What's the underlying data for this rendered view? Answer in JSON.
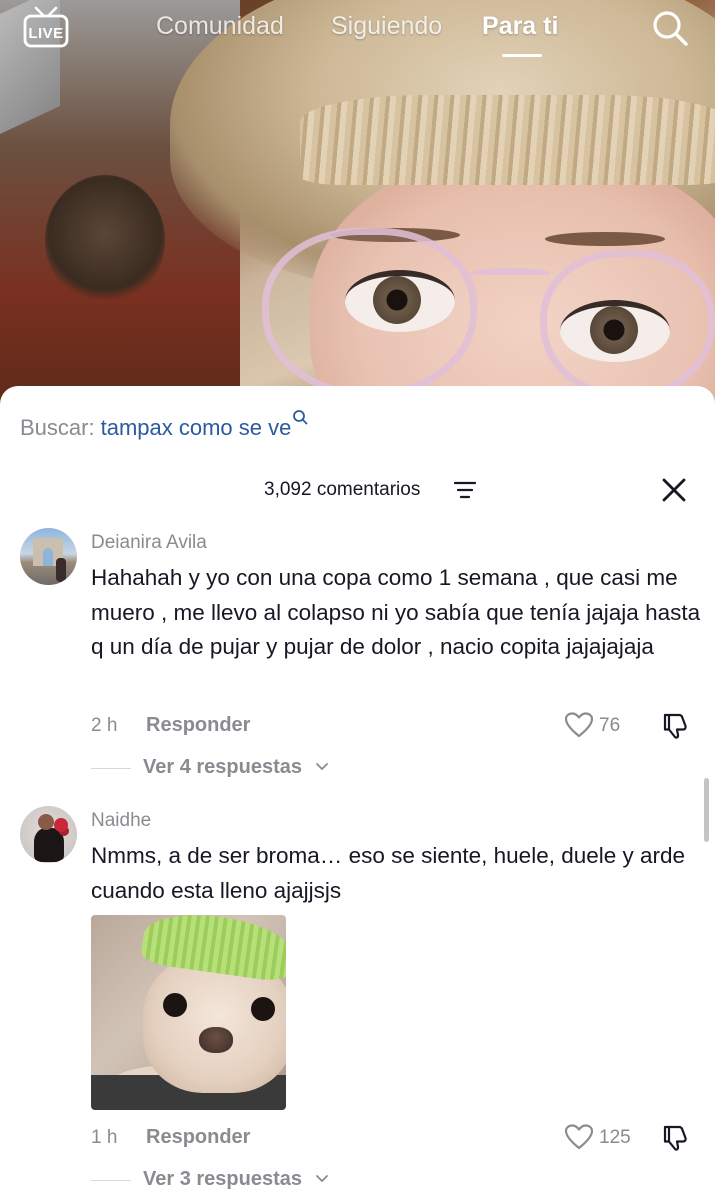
{
  "top_nav": {
    "live_label": "LIVE",
    "tabs": [
      {
        "label": "Comunidad",
        "active": false
      },
      {
        "label": "Siguiendo",
        "active": false
      },
      {
        "label": "Para ti",
        "active": true
      }
    ],
    "search_icon": "search-icon"
  },
  "comments_sheet": {
    "search_suggestion": {
      "prefix": "Buscar:",
      "query": "tampax como se ve",
      "icon": "search-icon",
      "query_color": "#2b5a9f"
    },
    "header": {
      "count_label": "3,092 comentarios",
      "sort_icon": "sort-icon",
      "close_icon": "close-icon"
    },
    "comments": [
      {
        "username": "Deianira Avila",
        "text": "Hahahah y yo con una copa como 1 semana , que casi me muero , me llevo al colapso ni yo sabía que tenía jajaja hasta q un día de pujar y pujar de dolor , nacio copita jajajajaja",
        "time": "2 h",
        "reply_label": "Responder",
        "likes": "76",
        "view_replies": "Ver 4 respuestas"
      },
      {
        "username": "Naidhe",
        "text": "Nmms, a de ser broma… eso se siente, huele, duele y arde cuando esta lleno ajajjsjs",
        "time": "1 h",
        "reply_label": "Responder",
        "likes": "125",
        "view_replies": "Ver 3 respuestas",
        "attachment": "puppy-image"
      }
    ]
  },
  "colors": {
    "text_primary": "#161823",
    "text_secondary": "#8a8b91",
    "link_blue": "#2b5a9f"
  }
}
